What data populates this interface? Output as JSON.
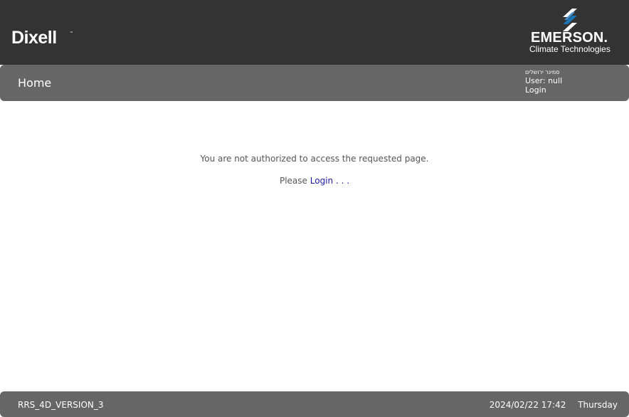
{
  "header": {
    "left_logo": "Dixell",
    "left_logo_mark": "™",
    "right_logo_name": "EMERSON.",
    "right_logo_sub": "Climate Technologies"
  },
  "nav": {
    "title": "Home",
    "site_name": "סמינר ירושלים",
    "user_text": "User: null",
    "login_label": "Login"
  },
  "content": {
    "unauthorized_message": "You are not authorized to access the requested page.",
    "please_text": "Please",
    "login_link": "Login . . ."
  },
  "footer": {
    "version": "RRS_4D_VERSION_3",
    "datetime": "2024/02/22 17:42",
    "day": "Thursday"
  },
  "colors": {
    "header_background": "#333333",
    "bar_background": "#666666",
    "link": "#1a1aa6",
    "emerson_blue": "#1a74b8"
  },
  "icons": {
    "emerson_mark": "emerson-logo-icon"
  }
}
